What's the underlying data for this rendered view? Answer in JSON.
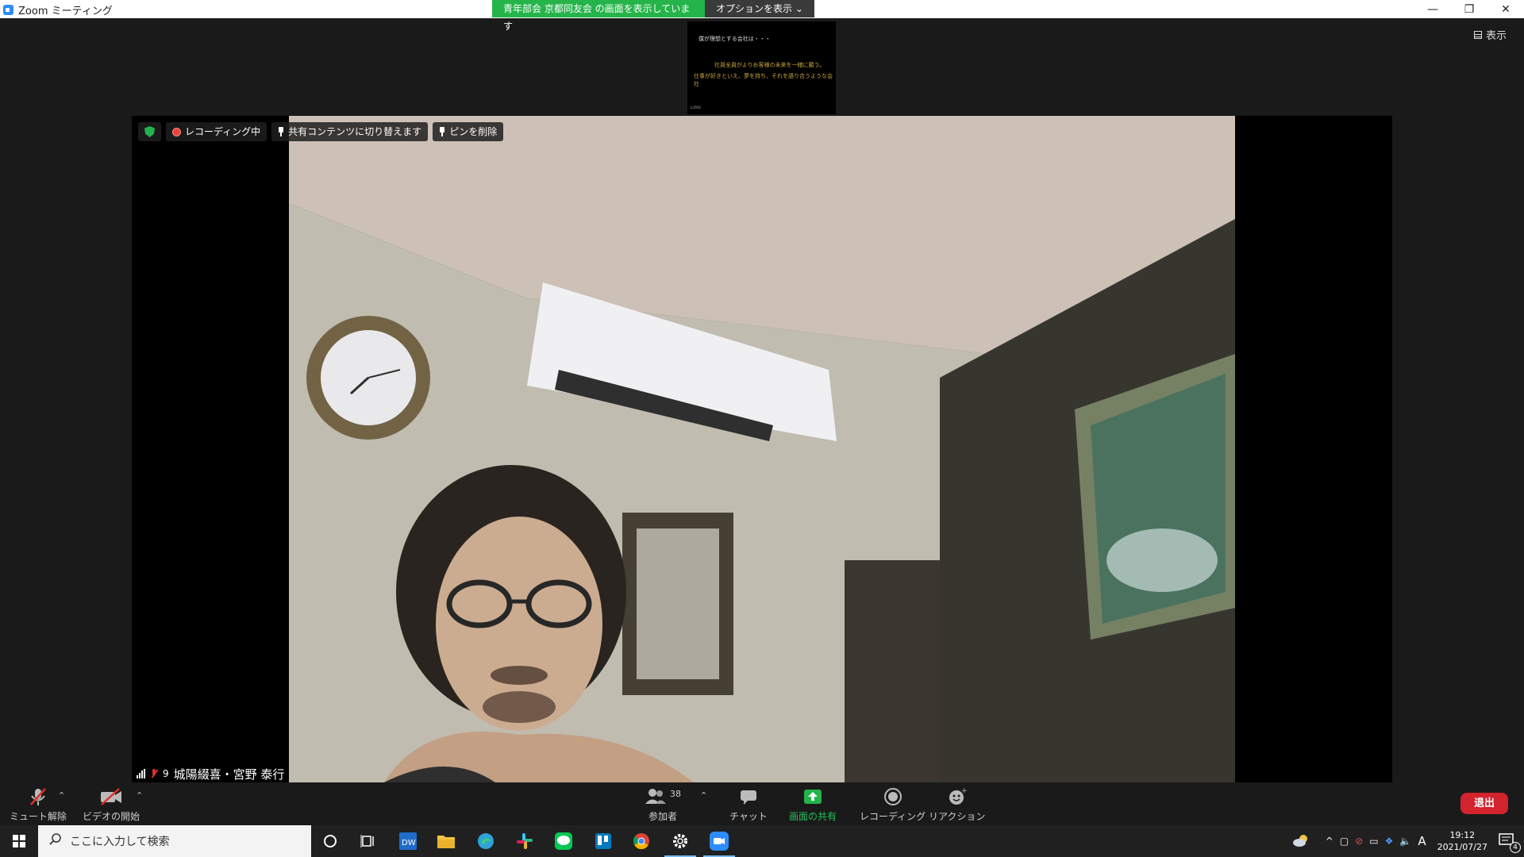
{
  "window": {
    "title": "Zoom ミーティング",
    "share_banner": "青年部会 京都同友会 の画面を表示しています",
    "options_label": "オプションを表示",
    "view_label": "表示"
  },
  "shared_screen": {
    "line1": "僕が理想とする会社は・・・",
    "line2": "社員全員がよりお客様の未来を一緒に願う。",
    "line3": "仕事が好きといえ、夢を持ち、それを語り合うような会社",
    "line4": "LINE"
  },
  "video": {
    "controls": {
      "recording": "レコーディング中",
      "switch_content": "共有コンテンツに切り替えます",
      "unpin": "ピンを削除"
    },
    "name_tag": {
      "count": "9",
      "name": "城陽綴喜・宮野 泰行"
    }
  },
  "toolbar": {
    "unmute": "ミュート解除",
    "start_video": "ビデオの開始",
    "participants": "参加者",
    "participant_count": "38",
    "chat": "チャット",
    "share": "画面の共有",
    "recording": "レコーディング",
    "reactions": "リアクション",
    "leave": "退出"
  },
  "taskbar": {
    "search_placeholder": "ここに入力して検索",
    "time": "19:12",
    "date": "2021/07/27",
    "ime": "A",
    "notifications": "4"
  },
  "colors": {
    "share_green": "#25b44a",
    "leave_red": "#d3232d",
    "zoom_blue": "#2d8cff"
  }
}
